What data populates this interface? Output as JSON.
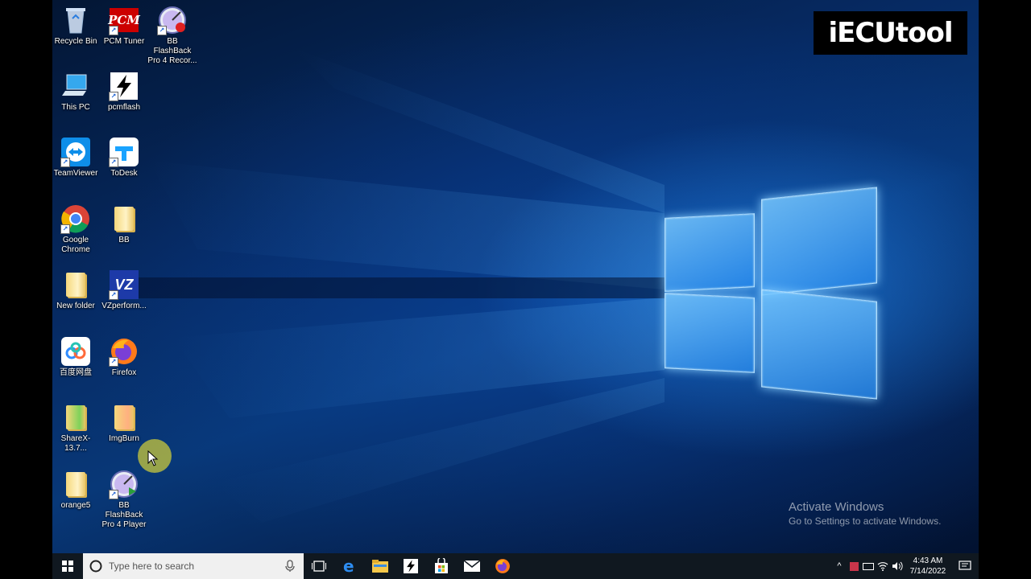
{
  "desktop": {
    "icons": [
      {
        "label": "Recycle Bin",
        "icon": "recycle-bin-icon"
      },
      {
        "label": "PCM Tuner",
        "icon": "pcm-tuner-icon"
      },
      {
        "label": "BB FlashBack Pro 4 Recor...",
        "icon": "bb-flashback-recorder-icon"
      },
      {
        "label": "This PC",
        "icon": "this-pc-icon"
      },
      {
        "label": "pcmflash",
        "icon": "pcmflash-icon"
      },
      {
        "label": "TeamViewer",
        "icon": "teamviewer-icon"
      },
      {
        "label": "ToDesk",
        "icon": "todesk-icon"
      },
      {
        "label": "Google Chrome",
        "icon": "chrome-icon"
      },
      {
        "label": "BB",
        "icon": "folder-icon"
      },
      {
        "label": "New folder",
        "icon": "folder-icon"
      },
      {
        "label": "VZperform...",
        "icon": "vzperformance-icon"
      },
      {
        "label": "百度网盘",
        "icon": "baidu-netdisk-icon"
      },
      {
        "label": "Firefox",
        "icon": "firefox-icon"
      },
      {
        "label": "ShareX-13.7...",
        "icon": "folder-icon"
      },
      {
        "label": "ImgBurn",
        "icon": "folder-icon"
      },
      {
        "label": "orange5",
        "icon": "folder-icon"
      },
      {
        "label": "BB FlashBack Pro 4 Player",
        "icon": "bb-flashback-player-icon"
      }
    ],
    "pcm_text": "PCM",
    "vz_text": "VZ"
  },
  "brand": {
    "text": "iECUtool"
  },
  "activation": {
    "title": "Activate Windows",
    "subtitle": "Go to Settings to activate Windows."
  },
  "taskbar": {
    "search_placeholder": "Type here to search",
    "clock_time": "4:43 AM",
    "clock_date": "7/14/2022"
  },
  "colors": {
    "accent": "#1e90ff",
    "taskbar": "#101820"
  }
}
